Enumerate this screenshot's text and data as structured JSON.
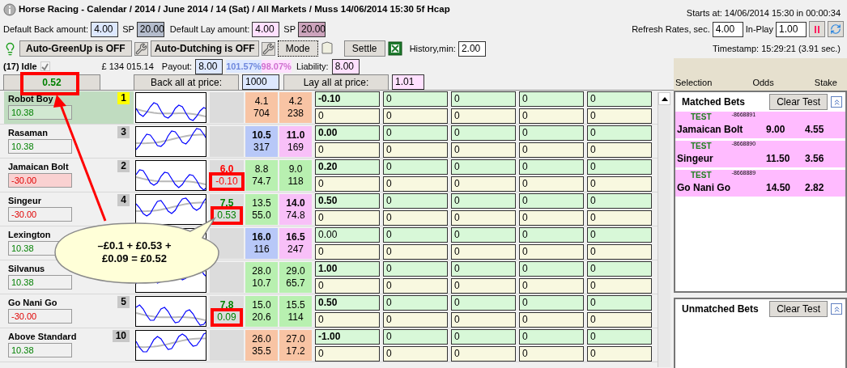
{
  "title": "Horse Racing - Calendar / 2014 / June 2014 / 14 (Sat) / All Markets / Muss 14/06/2014 15:30 5f Hcap",
  "starts_at": "Starts at: 14/06/2014 15:30 in 00:00:34",
  "defaults": {
    "back_label": "Default Back amount:",
    "back_value": "4.00",
    "back_sp_label": "SP",
    "back_sp": "20.00",
    "lay_label": "Default Lay amount:",
    "lay_value": "4.00",
    "lay_sp_label": "SP",
    "lay_sp": "20.00"
  },
  "refresh": {
    "label": "Refresh Rates, sec.",
    "value": "4.00",
    "inplay_label": "In-Play",
    "inplay_value": "1.00"
  },
  "toolbar": {
    "greenup": "Auto-GreenUp is OFF",
    "dutching": "Auto-Dutching is OFF",
    "mode": "Mode",
    "settle": "Settle",
    "history_label": "History,min:",
    "history_value": "2.00"
  },
  "timestamp": "Timestamp: 15:29:21 (3.91 sec.)",
  "status": {
    "label": "(17) Idle",
    "checkbox": {
      "checked": true,
      "disabled": true
    },
    "balance": "£ 134 015.14",
    "payout_label": "Payout:",
    "payout": "8.00",
    "back_book": "101.57%",
    "lay_book": "98.07%",
    "liability_label": "Liability:",
    "liability": "8.00"
  },
  "summary": {
    "total": "0.52",
    "highlighted": true,
    "back_all": "Back all at price:",
    "back_price": "1000",
    "lay_all": "Lay all at price:",
    "lay_price": "1.01"
  },
  "bets_header": [
    "Selection",
    "Odds",
    "Stake"
  ],
  "runners": [
    {
      "name": "Robot Boy",
      "number": "1",
      "selected": true,
      "pnl": {
        "value": "10.38",
        "color": "#008000",
        "highlighted": true
      },
      "back": {
        "price": "4.1",
        "size": "704",
        "color": "#f8c4a4",
        "bold": false
      },
      "lay": {
        "price": "4.2",
        "size": "238",
        "color": "#f8c4a4",
        "bold": false
      },
      "stake": "-0.10",
      "stake_bold": true,
      "ladder": [
        "0",
        "0",
        "0",
        "0",
        "0",
        "0",
        "0",
        "0",
        "0"
      ]
    },
    {
      "name": "Rasaman",
      "number": "3",
      "selected": false,
      "pnl": {
        "value": "10.38",
        "color": "#008000",
        "highlighted": false
      },
      "back": {
        "price": "10.5",
        "size": "317",
        "color": "#b8c8f8",
        "bold": true
      },
      "lay": {
        "price": "11.0",
        "size": "169",
        "color": "#f8c0f8",
        "bold": true
      },
      "stake": "0.00",
      "stake_bold": true,
      "ladder": [
        "0",
        "0",
        "0",
        "0",
        "0",
        "0",
        "0",
        "0",
        "0"
      ]
    },
    {
      "name": "Jamaican Bolt",
      "number": "2",
      "selected": false,
      "pnl": {
        "value": "-30.00",
        "color": "#e00000",
        "highlighted": true
      },
      "position": {
        "odds": "6.0",
        "value": "-0.10",
        "color": "#ff0000",
        "highlighted": true
      },
      "back": {
        "price": "8.8",
        "size": "74.7",
        "color": "#b8f0b0",
        "bold": false
      },
      "lay": {
        "price": "9.0",
        "size": "118",
        "color": "#b8f0b0",
        "bold": false
      },
      "stake": "0.20",
      "stake_bold": true,
      "ladder": [
        "0",
        "0",
        "0",
        "0",
        "0",
        "0",
        "0",
        "0",
        "0"
      ]
    },
    {
      "name": "Singeur",
      "number": "4",
      "selected": false,
      "pnl": {
        "value": "-30.00",
        "color": "#e00000",
        "highlighted": false
      },
      "position": {
        "odds": "7.5",
        "value": "0.53",
        "color": "#008000",
        "highlighted": true
      },
      "back": {
        "price": "13.5",
        "size": "55.0",
        "color": "#b8f0b0",
        "bold": false
      },
      "lay": {
        "price": "14.0",
        "size": "74.8",
        "color": "#f8c0f8",
        "bold": true
      },
      "stake": "0.50",
      "stake_bold": true,
      "ladder": [
        "0",
        "0",
        "0",
        "0",
        "0",
        "0",
        "0",
        "0",
        "0"
      ]
    },
    {
      "name": "Lexington",
      "selected": false,
      "pnl": {
        "value": "10.38",
        "color": "#008000",
        "highlighted": false
      },
      "back": {
        "price": "16.0",
        "size": "116",
        "color": "#b8c8f8",
        "bold": true
      },
      "lay": {
        "price": "16.5",
        "size": "247",
        "color": "#f8c0f8",
        "bold": true
      },
      "stake": "0.00",
      "stake_bold": false,
      "ladder": [
        "0",
        "0",
        "0",
        "0",
        "0",
        "0",
        "0",
        "0",
        "0"
      ]
    },
    {
      "name": "Silvanus",
      "selected": false,
      "pnl": {
        "value": "10.38",
        "color": "#008000",
        "highlighted": false
      },
      "back": {
        "price": "28.0",
        "size": "10.7",
        "color": "#b8f0b0",
        "bold": false
      },
      "lay": {
        "price": "29.0",
        "size": "65.7",
        "color": "#b8f0b0",
        "bold": false
      },
      "stake": "1.00",
      "stake_bold": true,
      "ladder": [
        "0",
        "0",
        "0",
        "0",
        "0",
        "0",
        "0",
        "0",
        "0"
      ]
    },
    {
      "name": "Go Nani Go",
      "number": "5",
      "selected": false,
      "pnl": {
        "value": "-30.00",
        "color": "#e00000",
        "highlighted": false
      },
      "position": {
        "odds": "7.8",
        "value": "0.09",
        "color": "#008000",
        "highlighted": true
      },
      "back": {
        "price": "15.0",
        "size": "20.6",
        "color": "#b8f0b0",
        "bold": false
      },
      "lay": {
        "price": "15.5",
        "size": "114",
        "color": "#b8f0b0",
        "bold": false
      },
      "stake": "0.50",
      "stake_bold": true,
      "ladder": [
        "0",
        "0",
        "0",
        "0",
        "0",
        "0",
        "0",
        "0",
        "0"
      ]
    },
    {
      "name": "Above Standard",
      "number": "10",
      "selected": false,
      "pnl": {
        "value": "10.38",
        "color": "#008000",
        "highlighted": false
      },
      "back": {
        "price": "26.0",
        "size": "35.5",
        "color": "#f8c4a4",
        "bold": false
      },
      "lay": {
        "price": "27.0",
        "size": "17.2",
        "color": "#f8c4a4",
        "bold": false
      },
      "stake": "-1.00",
      "stake_bold": true,
      "ladder": [
        "0",
        "0",
        "0",
        "0",
        "0",
        "0",
        "0",
        "0",
        "0"
      ]
    }
  ],
  "matched": {
    "title": "Matched Bets",
    "clear": "Clear Test",
    "bets": [
      {
        "tag": "TEST",
        "id": "-8668891",
        "selection": "Jamaican Bolt",
        "odds": "9.00",
        "stake": "4.55"
      },
      {
        "tag": "TEST",
        "id": "-8668890",
        "selection": "Singeur",
        "odds": "11.50",
        "stake": "3.56"
      },
      {
        "tag": "TEST",
        "id": "-8668889",
        "selection": "Go Nani Go",
        "odds": "14.50",
        "stake": "2.82"
      }
    ]
  },
  "unmatched": {
    "title": "Unmatched Bets",
    "clear": "Clear Test"
  },
  "callout": {
    "text": "–£0.1 + £0.53 + £0.09 = £0.52"
  }
}
